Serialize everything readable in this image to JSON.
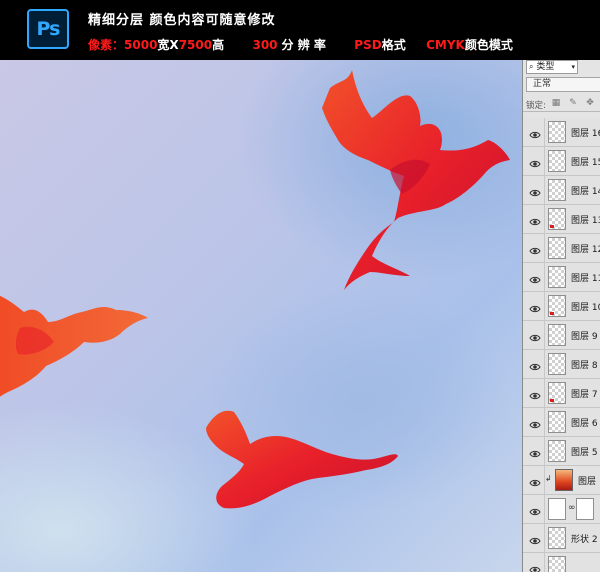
{
  "banner": {
    "app_logo": "Ps",
    "headline": "精细分层 颜色内容可随意修改",
    "specs": {
      "pixels_label": "像素：",
      "width": "5000",
      "by_width": "宽X",
      "height": "7500",
      "by_height": "高",
      "resolution": "300",
      "resolution_label": " 分 辨 率",
      "format": "PSD",
      "format_label": "格式",
      "color_mode": "CMYK",
      "color_mode_label": "颜色模式"
    }
  },
  "layers_panel": {
    "filter_kind": "类型",
    "blend_mode": "正常",
    "lock_label": "锁定:",
    "layers": [
      {
        "name": "图层 16",
        "visible": true
      },
      {
        "name": "图层 15",
        "visible": true
      },
      {
        "name": "图层 14",
        "visible": true
      },
      {
        "name": "图层 13",
        "visible": true
      },
      {
        "name": "图层 12",
        "visible": true
      },
      {
        "name": "图层 11",
        "visible": true
      },
      {
        "name": "图层 10",
        "visible": true
      },
      {
        "name": "图层 9",
        "visible": true
      },
      {
        "name": "图层 8",
        "visible": true
      },
      {
        "name": "图层 7",
        "visible": true
      },
      {
        "name": "图层 6",
        "visible": true
      },
      {
        "name": "图层 5",
        "visible": true
      },
      {
        "name": "图层",
        "visible": true
      },
      {
        "name": "",
        "visible": true
      },
      {
        "name": "形状 2",
        "visible": true
      },
      {
        "name": "",
        "visible": true
      }
    ]
  },
  "colors": {
    "banner_red": "#ff1a1a",
    "ps_blue": "#31a8ff",
    "dove_red": "#e8202a",
    "dove_orange": "#f2512a"
  }
}
